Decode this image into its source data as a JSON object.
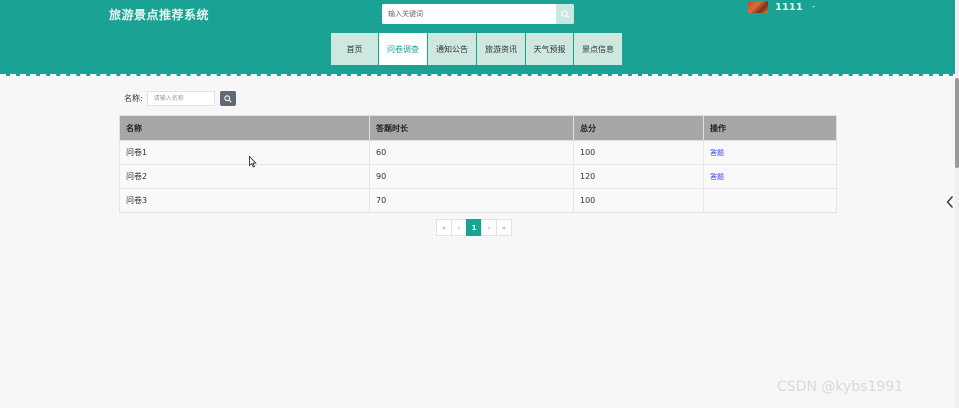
{
  "header": {
    "site_title": "旅游景点推荐系统",
    "search_placeholder": "输入关键词",
    "user_name": "1111",
    "user_caret": "-"
  },
  "nav": {
    "items": [
      {
        "label": "首页",
        "active": false
      },
      {
        "label": "问卷调查",
        "active": true
      },
      {
        "label": "通知公告",
        "active": false
      },
      {
        "label": "旅游资讯",
        "active": false
      },
      {
        "label": "天气预报",
        "active": false
      },
      {
        "label": "景点信息",
        "active": false
      }
    ]
  },
  "filter": {
    "label": "名称:",
    "placeholder": "请输入名称"
  },
  "table": {
    "headers": [
      "名称",
      "答题时长",
      "总分",
      "操作"
    ],
    "rows": [
      {
        "name": "问卷1",
        "duration": "60",
        "score": "100",
        "action": "答题"
      },
      {
        "name": "问卷2",
        "duration": "90",
        "score": "120",
        "action": "答题"
      },
      {
        "name": "问卷3",
        "duration": "70",
        "score": "100",
        "action": ""
      }
    ]
  },
  "pagination": {
    "first": "«",
    "prev": "‹",
    "current": "1",
    "next": "›",
    "last": "»"
  },
  "watermark": "CSDN @kybs1991",
  "colors": {
    "header_bg": "#1aa394",
    "nav_bg": "#cde8df",
    "table_header_bg": "#a7a7a7",
    "link": "#2a3bff"
  }
}
